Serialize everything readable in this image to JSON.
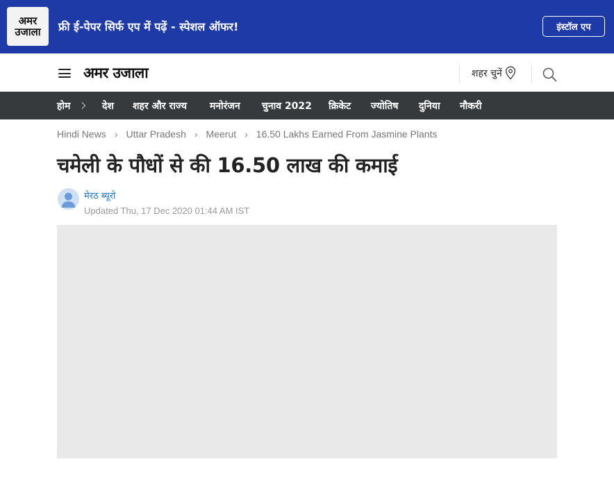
{
  "promo": {
    "logo_text": "अमर\nउजाला",
    "text": "फ्री ई-पेपर सिर्फ एप में पढ़ें - स्पेशल ऑफर!",
    "button_label": "इंस्टॉल एप"
  },
  "header": {
    "logo_text": "अमर उजाला",
    "city_label": "शहर चुनें",
    "icons": [
      "hamburger-menu-icon",
      "location-pin-icon",
      "search-icon"
    ]
  },
  "nav": {
    "items": [
      {
        "label": "होम"
      },
      {
        "label": "देश"
      },
      {
        "label": "शहर और राज्य"
      },
      {
        "label": "मनोरंजन"
      },
      {
        "label": "चुनाव 2022"
      },
      {
        "label": "क्रिकेट"
      },
      {
        "label": "ज्योतिष"
      },
      {
        "label": "दुनिया"
      },
      {
        "label": "नौकरी"
      }
    ]
  },
  "breadcrumb": {
    "items": [
      "Hindi News",
      "Uttar Pradesh",
      "Meerut"
    ],
    "separator": "›",
    "current": "16.50 Lakhs Earned From Jasmine Plants"
  },
  "article": {
    "title": "चमेली के पौधों से की 16.50 लाख की कमाई",
    "author": "मेरठ ब्यूरो",
    "updated": "Updated Thu, 17 Dec 2020 01:44 AM IST"
  },
  "colors": {
    "promo_bg": "#1e3aa6",
    "nav_bg": "#373a3c",
    "author_link": "#1a73c8",
    "placeholder": "#e9e9e9"
  }
}
